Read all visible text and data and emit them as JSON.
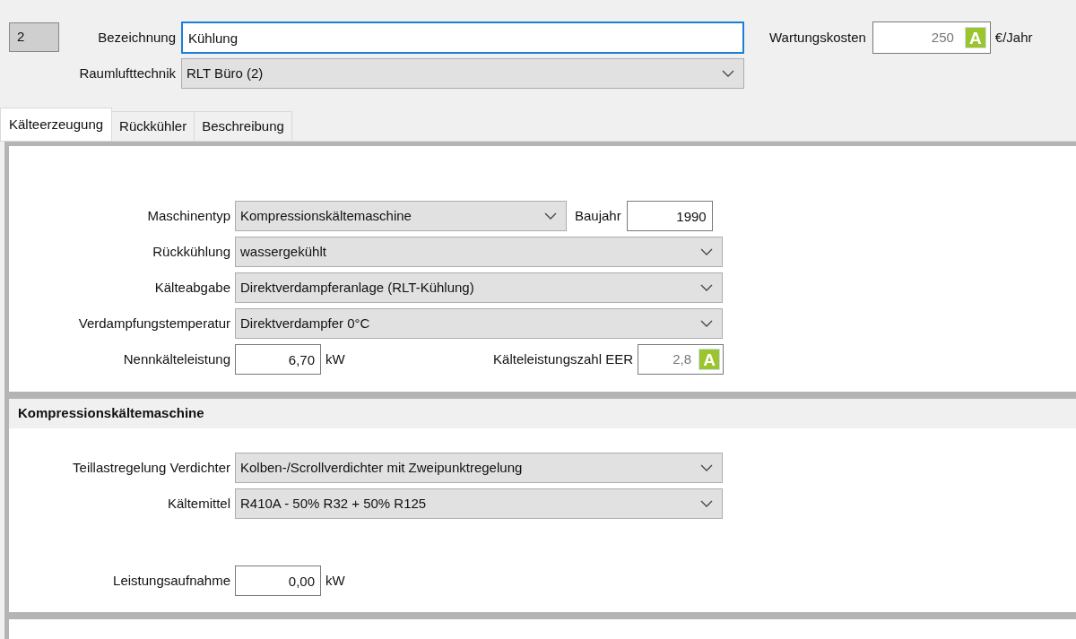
{
  "header": {
    "number": "2",
    "name_label": "Bezeichnung",
    "name_value": "Kühlung",
    "hvac_label": "Raumlufttechnik",
    "hvac_value": "RLT Büro (2)",
    "cost_label": "Wartungskosten",
    "cost_value": "250",
    "cost_badge": "A",
    "cost_unit": "€/Jahr"
  },
  "tabs": [
    {
      "label": "Kälteerzeugung",
      "selected": true
    },
    {
      "label": "Rückkühler",
      "selected": false
    },
    {
      "label": "Beschreibung",
      "selected": false
    }
  ],
  "sections": [
    {
      "rows": [
        {
          "kind": "select_year",
          "label": "Maschinentyp",
          "value": "Kompressionskältemaschine",
          "year_label": "Baujahr",
          "year": "1990"
        },
        {
          "kind": "select",
          "label": "Rückkühlung",
          "value": "wassergekühlt"
        },
        {
          "kind": "select",
          "label": "Kälteabgabe",
          "value": "Direktverdampferanlage (RLT-Kühlung)"
        },
        {
          "kind": "select",
          "label": "Verdampfungstemperatur",
          "value": "Direktverdampfer 0°C"
        },
        {
          "kind": "number_eer",
          "label": "Nennkälteleistung",
          "value": "6,70",
          "unit": "kW",
          "eer_label": "Kälteleistungszahl EER",
          "eer": "2,8",
          "eer_badge": "A"
        }
      ]
    },
    {
      "title": "Kompressionskältemaschine",
      "rows": [
        {
          "kind": "select",
          "label": "Teillastregelung Verdichter",
          "value": "Kolben-/Scrollverdichter mit Zweipunktregelung"
        },
        {
          "kind": "select",
          "label": "Kältemittel",
          "value": "R410A - 50% R32 + 50% R125"
        },
        {
          "kind": "gap"
        },
        {
          "kind": "number",
          "label": "Leistungsaufnahme",
          "value": "0,00",
          "unit": "kW"
        }
      ]
    }
  ]
}
